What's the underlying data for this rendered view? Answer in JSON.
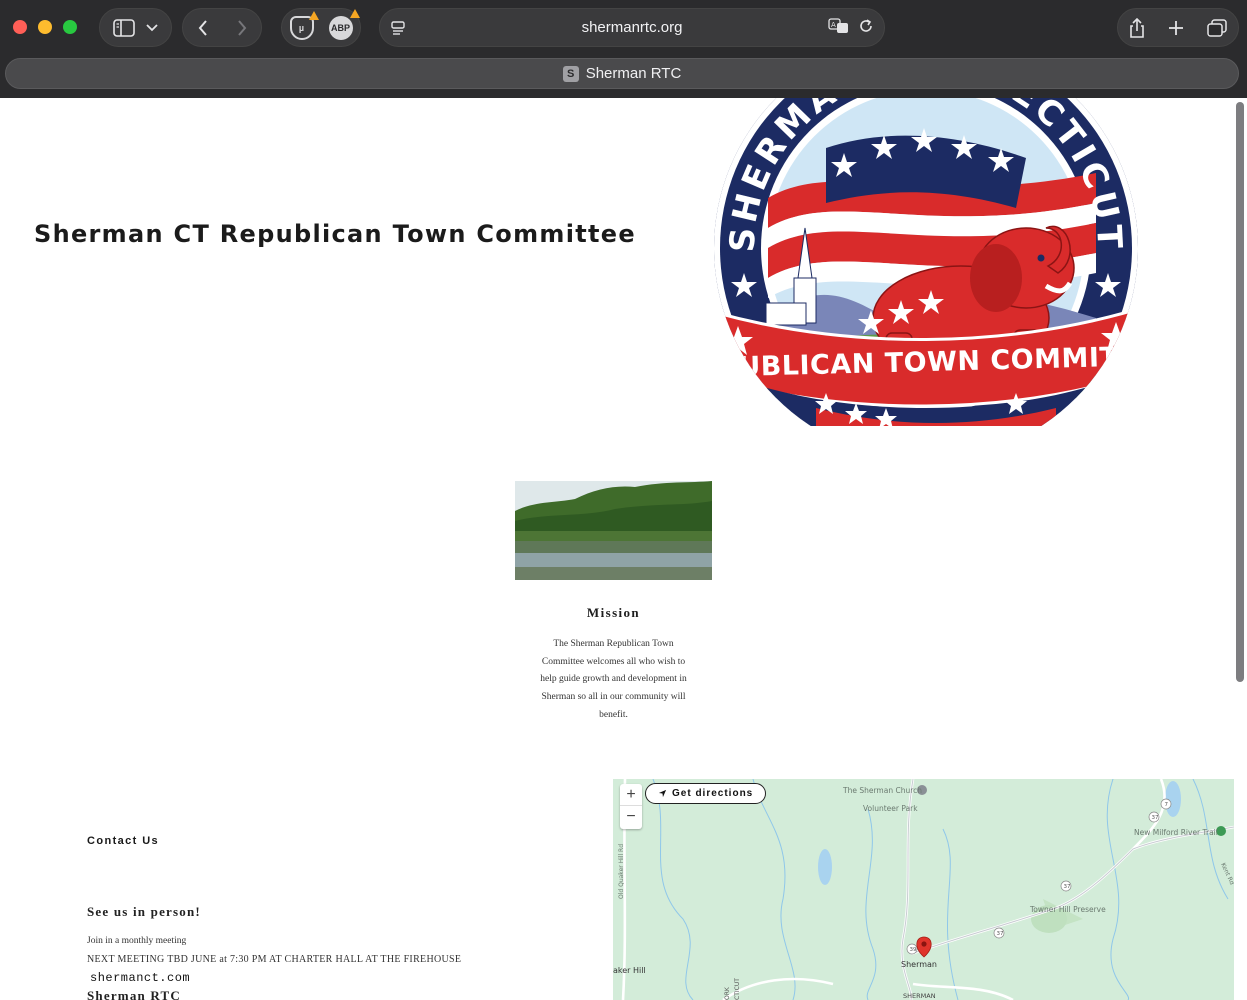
{
  "browser": {
    "url": "shermanrtc.org",
    "tab_title": "Sherman RTC",
    "tab_favicon": "S",
    "ext_ublock_label": "µ",
    "ext_abp_label": "ABP"
  },
  "header": {
    "title": "Sherman CT Republican Town Committee",
    "logo_top_text": "SHERMAN CONNECTICUT",
    "logo_banner_text": "REPUBLICAN TOWN COMMITTEE"
  },
  "mission": {
    "title": "Mission",
    "body": "The Sherman Republican Town Committee welcomes all who wish to help guide growth and development in Sherman so all in our community will benefit."
  },
  "contact": {
    "heading": "Contact Us",
    "person_heading": "See us in person!",
    "meeting_line": "Join in a monthly meeting",
    "next_meeting": "NEXT MEETING TBD JUNE at 7:30 PM AT CHARTER HALL AT THE FIREHOUSE",
    "site_link": "shermanct.com",
    "org_name": "Sherman RTC"
  },
  "map": {
    "zoom_in": "+",
    "zoom_out": "−",
    "directions_label": "Get directions",
    "labels": {
      "church": "The Sherman Church",
      "park": "Volunteer Park",
      "trail": "New Milford River Trail",
      "preserve": "Towner Hill Preserve",
      "town": "Sherman",
      "town_caps": "SHERMAN",
      "hill": "aker Hill",
      "road": "Old Quaker Hill Rd",
      "state": "CTICUT",
      "ork": "ORK",
      "kent_rd": "Kent Rd",
      "r37a": "37",
      "r37b": "37",
      "r39": "39",
      "r7": "7"
    }
  },
  "colors": {
    "chrome_bg": "#2b2b2d",
    "page_bg": "#ffffff",
    "map_bg": "#d3ecd9",
    "pin": "#e0342b",
    "logo_red": "#d92b2b",
    "logo_navy": "#1c2b63"
  }
}
